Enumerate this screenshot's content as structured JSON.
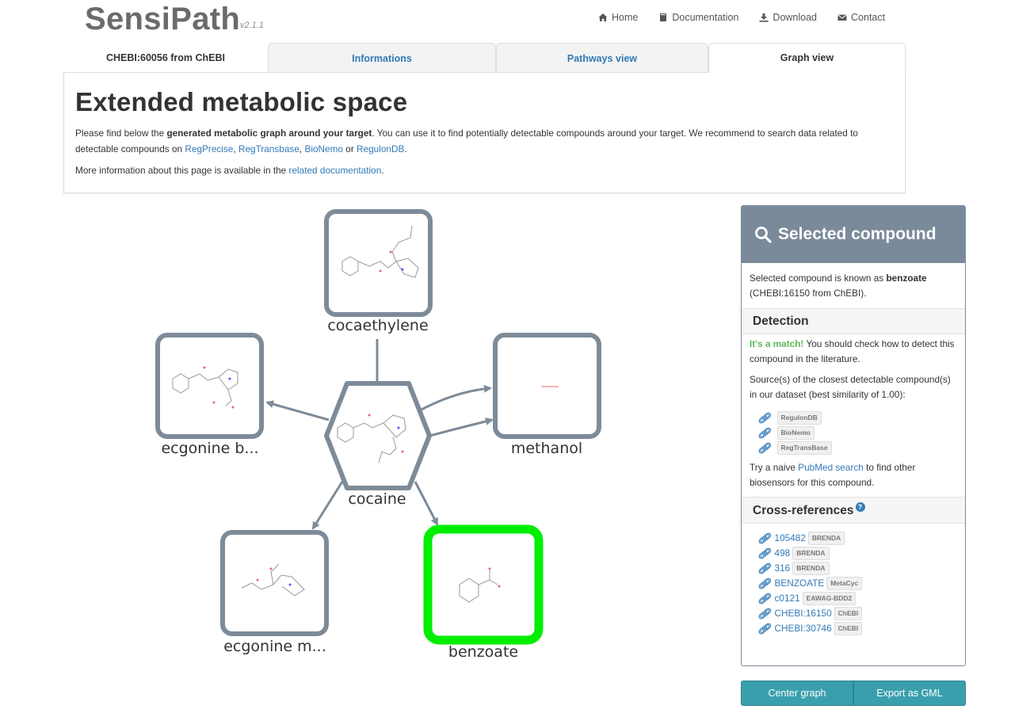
{
  "header": {
    "brand": "SensiPath",
    "version": "v2.1.1",
    "nav": [
      {
        "label": "Home",
        "icon": "home-icon"
      },
      {
        "label": "Documentation",
        "icon": "book-icon"
      },
      {
        "label": "Download",
        "icon": "download-icon"
      },
      {
        "label": "Contact",
        "icon": "envelope-icon"
      }
    ]
  },
  "tabs": {
    "target": "CHEBI:60056 from ChEBI",
    "informations": "Informations",
    "pathways": "Pathways view",
    "graph": "Graph view",
    "active": "Graph view"
  },
  "intro": {
    "title": "Extended metabolic space",
    "p1_pre": "Please find below the ",
    "p1_bold": "generated metabolic graph around your target",
    "p1_post": ". You can use it to find potentially detectable compounds around your target. We recommend to search data related to detectable compounds on ",
    "link_regprecise": "RegPrecise",
    "sep1": ", ",
    "link_regtransbase": "RegTransbase",
    "sep2": ", ",
    "link_bionemo": "BioNemo",
    "or": " or ",
    "link_regulondb": "RegulonDB",
    "end": ".",
    "p2_pre": "More information about this page is available in the ",
    "p2_link": "related documentation",
    "p2_end": "."
  },
  "graph": {
    "nodes": {
      "cocaine": "cocaine",
      "cocaethylene": "cocaethylene",
      "ecgonine_b": "ecgonine b...",
      "methanol": "methanol",
      "ecgonine_m": "ecgonine m...",
      "benzoate": "benzoate"
    },
    "colors": {
      "node_border": "#7d8b99",
      "selected_border": "#00ee00",
      "edge": "#7d8b99"
    }
  },
  "side": {
    "title": "Selected compound",
    "known_pre": "Selected compound is known as ",
    "known_name": "benzoate",
    "known_post": "(CHEBI:16150 from ChEBI).",
    "detection_title": "Detection",
    "match": "It's a match!",
    "match_post": " You should check how to detect this compound in the literature.",
    "sources_text": "Source(s) of the closest detectable compound(s) in our dataset (best similarity of 1.00):",
    "sources": [
      "RegulonDB",
      "BioNemo",
      "RegTransBase"
    ],
    "pubmed_pre": "Try a naive ",
    "pubmed_link": "PubMed search",
    "pubmed_post": " to find other biosensors for this compound.",
    "xref_title": "Cross-references",
    "xrefs": [
      {
        "id": "105482",
        "db": "BRENDA"
      },
      {
        "id": "498",
        "db": "BRENDA"
      },
      {
        "id": "316",
        "db": "BRENDA"
      },
      {
        "id": "BENZOATE",
        "db": "MetaCyc"
      },
      {
        "id": "c0121",
        "db": "EAWAG-BDD2"
      },
      {
        "id": "CHEBI:16150",
        "db": "ChEBI"
      },
      {
        "id": "CHEBI:30746",
        "db": "ChEBI"
      }
    ]
  },
  "buttons": {
    "center": "Center graph",
    "export": "Export as GML"
  }
}
